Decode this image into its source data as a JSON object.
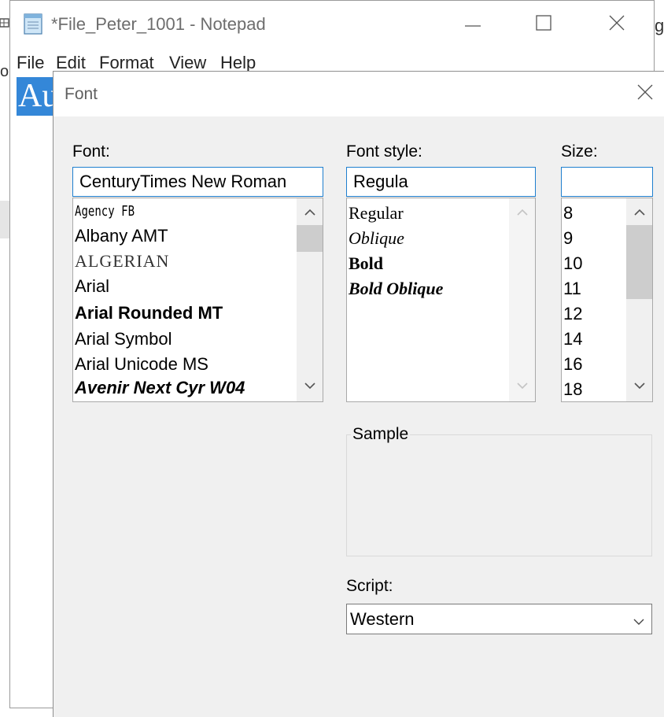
{
  "notepad": {
    "title": "*File_Peter_1001 - Notepad",
    "menu": [
      "File",
      "Edit",
      "Format",
      "View",
      "Help"
    ],
    "selected_text": "Au",
    "controls": {
      "minimize": "minimize-icon",
      "maximize": "maximize-icon",
      "close": "close-icon"
    }
  },
  "background": {
    "left_text": "ou",
    "right_text": "g"
  },
  "dialog": {
    "title": "Font",
    "font": {
      "label": "Font:",
      "value": "CenturyTimes New Roman",
      "items": [
        "Agency FB",
        "Albany AMT",
        "ALGERIAN",
        "Arial",
        "Arial Rounded MT",
        "Arial Symbol",
        "Arial Unicode MS",
        "Avenir Next Cyr W04"
      ]
    },
    "style": {
      "label": "Font style:",
      "value": "Regula",
      "items": [
        "Regular",
        "Oblique",
        "Bold",
        "Bold Oblique"
      ]
    },
    "size": {
      "label": "Size:",
      "value": "",
      "items": [
        "8",
        "9",
        "10",
        "11",
        "12",
        "14",
        "16",
        "18"
      ]
    },
    "sample": {
      "label": "Sample"
    },
    "script": {
      "label": "Script:",
      "value": "Western"
    }
  },
  "colors": {
    "accent": "#1f7fcf",
    "selection": "#3487d8",
    "dialog_bg": "#f0f0f0",
    "scroll_thumb": "#cdcdcd"
  }
}
